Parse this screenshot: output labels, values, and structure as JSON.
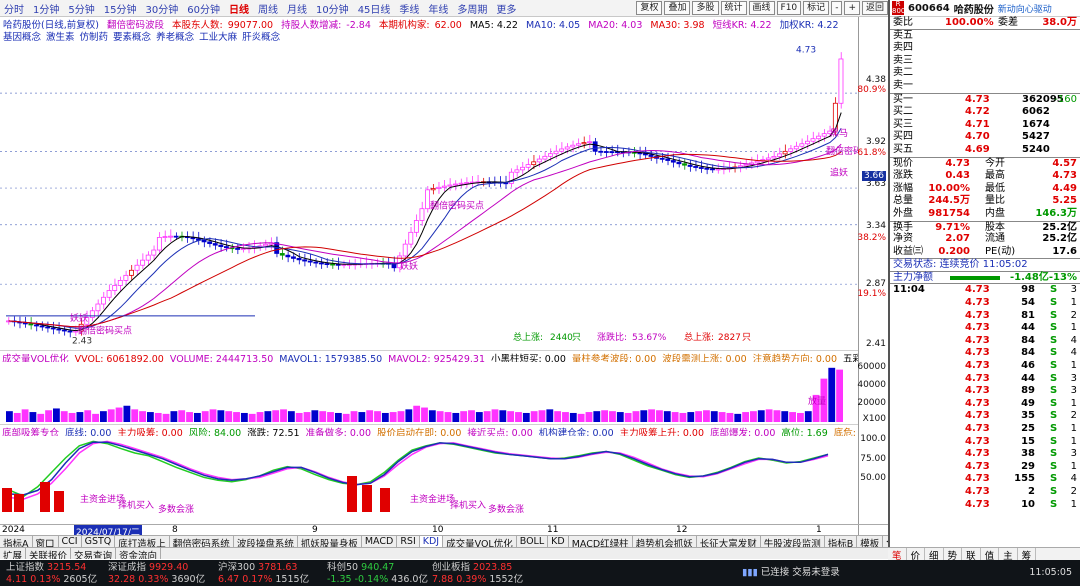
{
  "toolbar": {
    "periods": [
      "分时",
      "1分钟",
      "5分钟",
      "15分钟",
      "30分钟",
      "60分钟",
      "日线",
      "周线",
      "月线",
      "10分钟",
      "45日线",
      "季线",
      "年线",
      "多周期",
      "更多"
    ],
    "selected": "日线",
    "buttons": [
      "复权",
      "叠加",
      "多股",
      "统计",
      "画线",
      "F10",
      "标记",
      "-",
      "+",
      "返回"
    ]
  },
  "title": {
    "stock": "哈药股份(日线,前复权)",
    "ind": "翻倍密码波段",
    "holders_label": "本股东人数:",
    "holders": "99077.00",
    "reduce_label": "持股人数增减:",
    "reduce": "-2.84",
    "inst_label": "本期机构家:",
    "inst": "62.00",
    "ma5": "MA5: 4.22",
    "ma10": "MA10: 4.05",
    "ma20": "MA20: 4.03",
    "ma30": "MA30: 3.98",
    "kr1": "短线KR: 4.22",
    "kr2": "加权KR: 4.22"
  },
  "concepts": [
    "基因概念",
    "激生素",
    "仿制药",
    "要素概念",
    "养老概念",
    "工业大麻",
    "肝炎概念"
  ],
  "chip": {
    "a": "获利:4.15%",
    "b": "净利:74.67%"
  },
  "chart_labels": {
    "peak": "4.73",
    "low_mark": "2.43",
    "buy1": "翻倍密码买点",
    "buy2": "翻倍密码买点",
    "fan1": "妖妖",
    "fan2": "妖妖",
    "r1": "黑马",
    "r2": "翻倍密码",
    "r3": "追妖",
    "count_label_1": "总上涨:",
    "count_1": "2440",
    "count_unit_1": "只",
    "pct_label": "涨跌比:",
    "pct": "53.67%",
    "count_label_2": "总上涨:",
    "count_2": "2827",
    "count_unit_2": "只"
  },
  "yaxis": {
    "main": [
      "4.38",
      "80.9%",
      "3.92",
      "61.8%",
      "3.63",
      "3.34",
      "38.2%",
      "2.87",
      "19.1%",
      "2.41"
    ],
    "current": "3.66",
    "vol": [
      "60000",
      "40000",
      "20000",
      "X100"
    ],
    "ind": [
      "100.0",
      "75.00",
      "50.00"
    ]
  },
  "volume": {
    "head": [
      "成交量VOL优化",
      "VVOL: 6061892.00",
      "VOLUME: 2444713.50",
      "MAVOL1: 1579385.50",
      "MAVOL2: 925429.31",
      "小黑柱短买: 0.00",
      "量柱参考波段: 0.00",
      "波段需测上涨: 0.00",
      "注意趋势方向: 0.00",
      "五彩柱黑马: 0.00",
      "关键趋势"
    ],
    "tag": "放量",
    "bars": [
      12,
      10,
      14,
      11,
      9,
      13,
      15,
      12,
      10,
      11,
      13,
      9,
      12,
      14,
      16,
      18,
      14,
      12,
      11,
      10,
      9,
      12,
      13,
      11,
      10,
      12,
      14,
      13,
      12,
      11,
      10,
      9,
      11,
      12,
      13,
      14,
      12,
      10,
      11,
      13,
      12,
      11,
      10,
      9,
      12,
      11,
      13,
      12,
      10,
      11,
      12,
      14,
      18,
      16,
      13,
      12,
      11,
      10,
      12,
      13,
      11,
      12,
      14,
      13,
      12,
      11,
      10,
      12,
      13,
      14,
      12,
      11,
      10,
      9,
      11,
      12,
      13,
      12,
      11,
      10,
      12,
      13,
      14,
      13,
      12,
      11,
      10,
      11,
      12,
      13,
      12,
      11,
      10,
      9,
      11,
      12,
      13,
      14,
      13,
      12,
      11,
      10,
      12,
      30,
      48,
      60,
      58
    ]
  },
  "indicator": {
    "head": [
      "底部吸筹专仓",
      "底线: 0.00",
      "主力吸筹: 0.00",
      "风险: 84.00",
      "涨跌: 72.51",
      "准备做多: 0.00",
      "股价启动在即: 0.00",
      "接近买点: 0.00",
      "机构建仓金: 0.00",
      "主力吸筹上升: 0.00",
      "底部爆发: 0.00",
      "高位: 1.69",
      "底危: 80.07",
      "动态底部: 0"
    ],
    "labels": [
      "主资金进场",
      "择机买入",
      "多数会涨",
      "主资金进场",
      "择机买入",
      "多数会涨"
    ],
    "green": [
      30,
      22,
      35,
      55,
      75,
      92,
      98,
      95,
      88,
      82,
      78,
      70,
      62,
      55,
      48,
      44,
      42,
      45,
      50,
      58,
      63,
      60,
      52,
      45,
      40,
      38,
      42,
      55,
      72,
      86,
      92,
      96,
      94,
      90,
      86,
      82,
      80,
      78,
      76,
      74,
      75,
      78,
      82,
      84,
      80,
      72,
      64,
      58,
      52,
      48,
      50,
      55,
      62,
      70,
      75,
      72,
      68,
      70,
      75,
      80
    ],
    "red": [
      20,
      18,
      25,
      40,
      60,
      82,
      95,
      98,
      94,
      88,
      82,
      76,
      68,
      60,
      53,
      48,
      45,
      46,
      48,
      54,
      60,
      62,
      56,
      48,
      42,
      38,
      40,
      50,
      66,
      80,
      90,
      95,
      96,
      92,
      88,
      84,
      81,
      79,
      77,
      75,
      74,
      76,
      80,
      83,
      82,
      76,
      68,
      60,
      54,
      50,
      49,
      53,
      60,
      67,
      73,
      73,
      69,
      69,
      73,
      78
    ],
    "blue": [
      25,
      24,
      30,
      45,
      68,
      88,
      97,
      97,
      92,
      86,
      80,
      74,
      66,
      58,
      51,
      46,
      44,
      46,
      50,
      56,
      62,
      62,
      55,
      47,
      41,
      38,
      40,
      52,
      70,
      84,
      91,
      96,
      95,
      91,
      87,
      83,
      80,
      78,
      76,
      74,
      74,
      77,
      81,
      84,
      81,
      74,
      66,
      59,
      53,
      49,
      50,
      54,
      61,
      69,
      74,
      73,
      69,
      69,
      74,
      80
    ]
  },
  "dates": [
    "2024",
    "2024/07/17/二",
    "8",
    "9",
    "10",
    "11",
    "12",
    "1"
  ],
  "tabs1": [
    "指标A",
    "窗口",
    "CCI",
    "GSTQ",
    "底打造板上",
    "翻倍密码系统",
    "波段操盘系统",
    "抓妖股量身板",
    "MACD",
    "RSI",
    "KDJ",
    "成交量VOL优化",
    "BOLL",
    "KD",
    "MACD红绿柱",
    "趋势机会抓妖",
    "长征大富发财",
    "牛股波段监测",
    "指标B",
    "模板",
    "◀"
  ],
  "tabs2": [
    "扩展",
    "关联报价",
    "交易查询",
    "资金流向"
  ],
  "quote": {
    "code": "600664",
    "name": "哈药股份",
    "tag": "新动向心驱动",
    "weibi_label": "委比",
    "weibi": "100.00%",
    "weicha_label": "委差",
    "weicha": "38.0万",
    "sells": [
      "卖五",
      "卖四",
      "卖三",
      "卖二",
      "卖一"
    ],
    "buys": [
      {
        "label": "买一",
        "price": "4.73",
        "vol": "362095",
        "chg": "-160"
      },
      {
        "label": "买二",
        "price": "4.72",
        "vol": "6062",
        "chg": ""
      },
      {
        "label": "买三",
        "price": "4.71",
        "vol": "1674",
        "chg": ""
      },
      {
        "label": "买四",
        "price": "4.70",
        "vol": "5427",
        "chg": ""
      },
      {
        "label": "买五",
        "price": "4.69",
        "vol": "5240",
        "chg": ""
      }
    ],
    "stats": [
      [
        "现价",
        "4.73",
        "今开",
        "4.57"
      ],
      [
        "涨跌",
        "0.43",
        "最高",
        "4.73"
      ],
      [
        "涨幅",
        "10.00%",
        "最低",
        "4.49"
      ],
      [
        "总量",
        "244.5万",
        "量比",
        "5.25"
      ],
      [
        "外盘",
        "981754",
        "内盘",
        "146.3万"
      ],
      [
        "换手",
        "9.71%",
        "股本",
        "25.2亿"
      ],
      [
        "净资",
        "2.07",
        "流通",
        "25.2亿"
      ],
      [
        "收益㈢",
        "0.200",
        "PE(动)",
        "17.6"
      ]
    ],
    "trade_status": "交易状态: 连续竞价 11:05:02",
    "net_label": "主力净额",
    "net_value": "-1.48亿",
    "net_pct": "-13%",
    "ticks": [
      {
        "t": "11:04",
        "p": "4.73",
        "v": "98",
        "d": "S",
        "n": "3"
      },
      {
        "t": "",
        "p": "4.73",
        "v": "54",
        "d": "S",
        "n": "1"
      },
      {
        "t": "",
        "p": "4.73",
        "v": "81",
        "d": "S",
        "n": "2"
      },
      {
        "t": "",
        "p": "4.73",
        "v": "44",
        "d": "S",
        "n": "1"
      },
      {
        "t": "",
        "p": "4.73",
        "v": "84",
        "d": "S",
        "n": "4"
      },
      {
        "t": "",
        "p": "4.73",
        "v": "84",
        "d": "S",
        "n": "4"
      },
      {
        "t": "",
        "p": "4.73",
        "v": "46",
        "d": "S",
        "n": "1"
      },
      {
        "t": "",
        "p": "4.73",
        "v": "44",
        "d": "S",
        "n": "3"
      },
      {
        "t": "",
        "p": "4.73",
        "v": "89",
        "d": "S",
        "n": "3"
      },
      {
        "t": "",
        "p": "4.73",
        "v": "49",
        "d": "S",
        "n": "1"
      },
      {
        "t": "",
        "p": "4.73",
        "v": "35",
        "d": "S",
        "n": "2"
      },
      {
        "t": "",
        "p": "4.73",
        "v": "25",
        "d": "S",
        "n": "1"
      },
      {
        "t": "",
        "p": "4.73",
        "v": "15",
        "d": "S",
        "n": "1"
      },
      {
        "t": "",
        "p": "4.73",
        "v": "38",
        "d": "S",
        "n": "3"
      },
      {
        "t": "",
        "p": "4.73",
        "v": "29",
        "d": "S",
        "n": "1"
      },
      {
        "t": "",
        "p": "4.73",
        "v": "155",
        "d": "S",
        "n": "4"
      },
      {
        "t": "",
        "p": "4.73",
        "v": "2",
        "d": "S",
        "n": "2"
      },
      {
        "t": "",
        "p": "4.73",
        "v": "10",
        "d": "S",
        "n": "1"
      }
    ],
    "bottom_tabs": [
      "笔",
      "价",
      "细",
      "势",
      "联",
      "值",
      "主",
      "筹"
    ]
  },
  "status": {
    "items": [
      {
        "name": "上证指数",
        "value": "3215.54",
        "chg": "4.11",
        "pct": "0.13%",
        "amt": "2605亿",
        "dir": "up"
      },
      {
        "name": "深证成指",
        "value": "9929.40",
        "chg": "32.28",
        "pct": "0.33%",
        "amt": "3690亿",
        "dir": "up"
      },
      {
        "name": "沪深300",
        "value": "3781.63",
        "chg": "6.47",
        "pct": "0.17%",
        "amt": "1515亿",
        "dir": "up"
      },
      {
        "name": "科创50",
        "value": "940.47",
        "chg": "-1.35",
        "pct": "-0.14%",
        "amt": "436.0亿",
        "dir": "dn"
      },
      {
        "name": "创业板指",
        "value": "2023.85",
        "chg": "7.88",
        "pct": "0.39%",
        "amt": "1552亿",
        "dir": "up"
      }
    ],
    "connection": "已连接 交易未登录",
    "time": "11:05:05"
  },
  "colors": {
    "up": "#e00000",
    "down": "#009900",
    "accent": "#1b2fb5",
    "magenta": "#ff33ff"
  }
}
